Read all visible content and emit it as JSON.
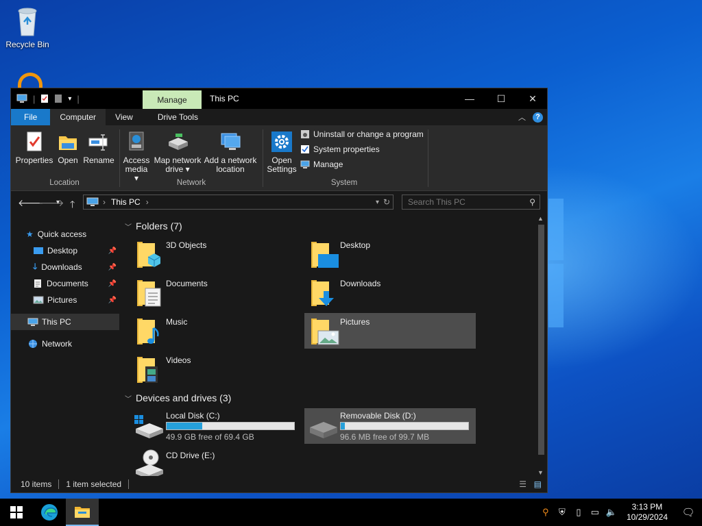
{
  "desktop": {
    "recycle_bin_label": "Recycle Bin"
  },
  "window": {
    "title": "This PC",
    "contextual_tab": "Manage",
    "min_glyph": "—",
    "max_glyph": "☐",
    "close_glyph": "✕"
  },
  "ribbon": {
    "tabs": [
      "File",
      "Computer",
      "View",
      "Drive Tools"
    ],
    "location": {
      "label": "Location",
      "properties": "Properties",
      "open": "Open",
      "rename": "Rename"
    },
    "network": {
      "label": "Network",
      "access_media_1": "Access",
      "access_media_2": "media ▾",
      "map_drive_1": "Map network",
      "map_drive_2": "drive ▾",
      "add_location_1": "Add a network",
      "add_location_2": "location"
    },
    "system": {
      "label": "System",
      "open_settings_1": "Open",
      "open_settings_2": "Settings",
      "uninstall": "Uninstall or change a program",
      "system_properties": "System properties",
      "manage": "Manage"
    }
  },
  "address": {
    "path": "This PC",
    "search_placeholder": "Search This PC"
  },
  "nav": {
    "quick_access": "Quick access",
    "items": [
      {
        "label": "Desktop"
      },
      {
        "label": "Downloads"
      },
      {
        "label": "Documents"
      },
      {
        "label": "Pictures"
      }
    ],
    "this_pc": "This PC",
    "network": "Network"
  },
  "content": {
    "folders_header": "Folders (7)",
    "folders": [
      {
        "name": "3D Objects"
      },
      {
        "name": "Desktop"
      },
      {
        "name": "Documents"
      },
      {
        "name": "Downloads"
      },
      {
        "name": "Music"
      },
      {
        "name": "Pictures"
      },
      {
        "name": "Videos"
      }
    ],
    "devices_header": "Devices and drives (3)",
    "drives": [
      {
        "name": "Local Disk (C:)",
        "free": "49.9 GB free of 69.4 GB",
        "used_fraction": 0.28
      },
      {
        "name": "Removable Disk (D:)",
        "free": "96.6 MB free of 99.7 MB",
        "used_fraction": 0.03
      },
      {
        "name": "CD Drive (E:)"
      }
    ]
  },
  "status": {
    "items": "10 items",
    "selected": "1 item selected"
  },
  "taskbar": {
    "time": "3:13 PM",
    "date": "10/29/2024"
  },
  "colors": {
    "accent": "#1979ca",
    "manage_tab": "#c9e9b7",
    "drive_bar": "#26a0da"
  }
}
